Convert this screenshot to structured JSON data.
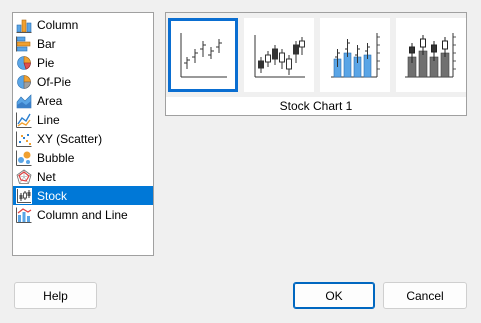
{
  "chart_types": {
    "items": [
      {
        "label": "Column",
        "icon": "column-chart-icon"
      },
      {
        "label": "Bar",
        "icon": "bar-chart-icon"
      },
      {
        "label": "Pie",
        "icon": "pie-chart-icon"
      },
      {
        "label": "Of-Pie",
        "icon": "of-pie-chart-icon"
      },
      {
        "label": "Area",
        "icon": "area-chart-icon"
      },
      {
        "label": "Line",
        "icon": "line-chart-icon"
      },
      {
        "label": "XY (Scatter)",
        "icon": "scatter-chart-icon"
      },
      {
        "label": "Bubble",
        "icon": "bubble-chart-icon"
      },
      {
        "label": "Net",
        "icon": "net-chart-icon"
      },
      {
        "label": "Stock",
        "icon": "stock-chart-icon",
        "selected": true
      },
      {
        "label": "Column and Line",
        "icon": "column-and-line-chart-icon"
      }
    ]
  },
  "subtypes": {
    "caption": "Stock Chart 1",
    "items": [
      {
        "icon": "stock-chart-1-icon",
        "selected": true
      },
      {
        "icon": "stock-chart-2-icon"
      },
      {
        "icon": "stock-chart-3-icon"
      },
      {
        "icon": "stock-chart-4-icon"
      }
    ]
  },
  "buttons": {
    "help": "Help",
    "ok": "OK",
    "cancel": "Cancel"
  },
  "colors": {
    "selection": "#0078d7",
    "subtype_selection_border": "#0a6ed1",
    "chart_blue": "#5aa5e6",
    "chart_gray": "#707070"
  }
}
